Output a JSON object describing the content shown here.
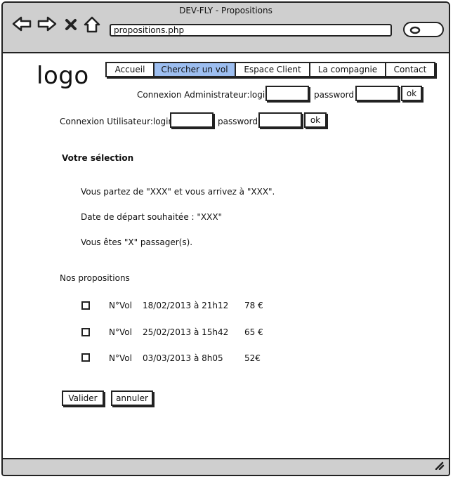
{
  "window": {
    "title": "DEV-FLY - Propositions"
  },
  "toolbar": {
    "url": "propositions.php"
  },
  "icons": {
    "back": "arrow-left-icon",
    "forward": "arrow-right-icon",
    "stop": "close-icon",
    "home": "home-icon",
    "search": "search-icon",
    "resize": "resize-grip-icon"
  },
  "header": {
    "logo": "logo"
  },
  "menu": {
    "items": [
      {
        "label": "Accueil",
        "active": false
      },
      {
        "label": "Chercher un vol",
        "active": true
      },
      {
        "label": "Espace Client",
        "active": false
      },
      {
        "label": "La compagnie",
        "active": false
      },
      {
        "label": "Contact",
        "active": false
      }
    ]
  },
  "admin_login": {
    "label": "Connexion Administrateur:login",
    "password_label": "password",
    "ok_label": "ok"
  },
  "user_login": {
    "label": "Connexion Utilisateur:login",
    "password_label": "password",
    "ok_label": "ok"
  },
  "selection": {
    "title": "Votre sélection",
    "route": "Vous partez de  \"XXX\" et vous arrivez à \"XXX\".",
    "date": "Date de départ souhaitée : \"XXX\"",
    "passengers": "Vous êtes \"X\" passager(s)."
  },
  "propositions": {
    "title": "Nos propositions",
    "rows": [
      {
        "num": "N°Vol",
        "date": "18/02/2013 à 21h12",
        "price": "78 €"
      },
      {
        "num": "N°Vol",
        "date": "25/02/2013 à 15h42",
        "price": "65 €"
      },
      {
        "num": "N°Vol",
        "date": "03/03/2013 à 8h05",
        "price": "52€"
      }
    ]
  },
  "actions": {
    "validate_label": "Valider",
    "cancel_label": "annuler"
  },
  "colors": {
    "active_tab": "#9dbef0",
    "chrome": "#cfcfcf"
  }
}
